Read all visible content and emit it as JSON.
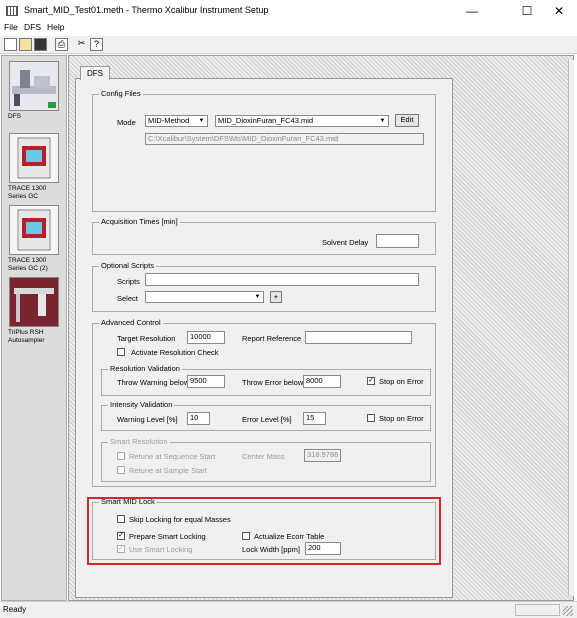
{
  "window": {
    "title": "Smart_MID_Test01.meth - Thermo Xcalibur Instrument Setup",
    "minimize_glyph": "—",
    "maximize_glyph": "☐",
    "close_glyph": "✕"
  },
  "menu": [
    "File",
    "DFS",
    "Help"
  ],
  "toolbar_icons": [
    "new-icon",
    "open-icon",
    "save-icon",
    "print-icon",
    "cut-icon",
    "help-icon"
  ],
  "instruments": [
    {
      "label": "DFS"
    },
    {
      "label": "TRACE 1300 Series GC"
    },
    {
      "label": "TRACE 1300 Series GC (2)"
    },
    {
      "label": "TriPlus RSH Autosampler"
    }
  ],
  "tab": "DFS",
  "config_files": {
    "title": "Config Files",
    "mode_label": "Mode",
    "mode_value": "MID-Method",
    "file_value": "MID_DioxinFuran_FC43.mid",
    "edit_label": "Edit",
    "path": "C:\\Xcalibur\\System\\DFS\\Ms\\MID_DioxinFuran_FC43.mid"
  },
  "acquisition": {
    "title": "Acquisition Times [min]",
    "solvent_delay_label": "Solvent Delay",
    "solvent_delay_value": ""
  },
  "optional_scripts": {
    "title": "Optional Scripts",
    "scripts_label": "Scripts",
    "scripts_value": "",
    "select_label": "Select",
    "select_value": "",
    "add_label": "+"
  },
  "advanced": {
    "title": "Advanced  Control",
    "target_resolution_label": "Target Resolution",
    "target_resolution_value": "10000",
    "report_reference_label": "Report Reference",
    "report_reference_value": "",
    "activate_check_label": "Activate Resolution Check",
    "activate_check_checked": false
  },
  "resolution_validation": {
    "title": "Resolution Validation",
    "warning_label": "Throw Warning below",
    "warning_value": "9500",
    "error_label": "Throw Error below",
    "error_value": "8000",
    "stop_label": "Stop on Error",
    "stop_checked": true
  },
  "intensity_validation": {
    "title": "Intensity Validation",
    "warning_label": "Warning Level [%]",
    "warning_value": "10",
    "error_label": "Error Level [%]",
    "error_value": "15",
    "stop_label": "Stop on Error",
    "stop_checked": false
  },
  "smart_resolution": {
    "title": "Smart Resolution",
    "retune_sequence_label": "Retune at Sequence Start",
    "retune_sample_label": "Retune at Sample Start",
    "center_mass_label": "Center Mass",
    "center_mass_value": "318.9786"
  },
  "smart_mid_lock": {
    "title": "Smart MID Lock",
    "skip_label": "Skip Locking for equal Masses",
    "skip_checked": false,
    "prepare_label": "Prepare Smart Locking",
    "prepare_checked": true,
    "actualize_label": "Actualize Ecorr Table",
    "actualize_checked": false,
    "use_label": "Use Smart Locking",
    "use_checked": true,
    "lock_width_label": "Lock Width  [ppm]",
    "lock_width_value": "200"
  },
  "status": "Ready",
  "colors": {
    "highlight": "#d6262b"
  }
}
